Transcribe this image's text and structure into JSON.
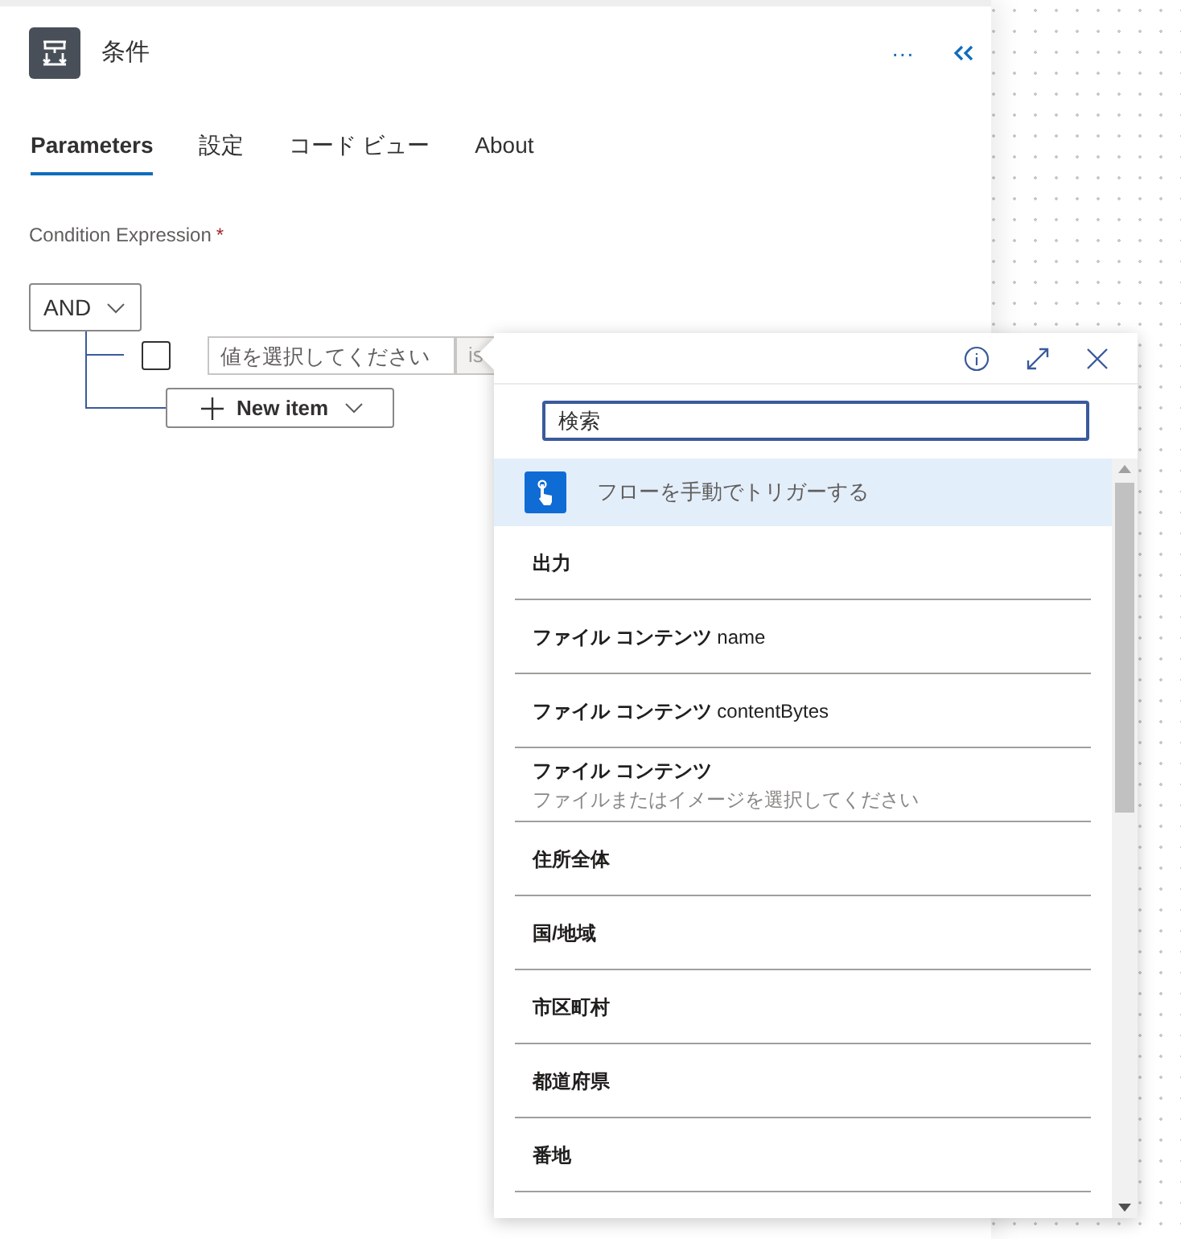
{
  "header": {
    "title": "条件",
    "more": "···"
  },
  "tabs": [
    {
      "label": "Parameters",
      "selected": true
    },
    {
      "label": "設定",
      "selected": false
    },
    {
      "label": "コード ビュー",
      "selected": false
    },
    {
      "label": "About",
      "selected": false
    }
  ],
  "condition": {
    "label": "Condition Expression",
    "required_mark": "*",
    "group": "AND",
    "rows": [
      {
        "checked": false,
        "value_placeholder": "値を選択してください",
        "operator": "is"
      }
    ],
    "new_item": "New item"
  },
  "picker": {
    "search_placeholder": "検索",
    "items": [
      {
        "kind": "trigger",
        "title": "フローを手動でトリガーする",
        "selected": true
      },
      {
        "kind": "field",
        "title": "出力",
        "selected": false
      },
      {
        "kind": "field",
        "title": "**ファイル コンテンツ** name",
        "selected": false
      },
      {
        "kind": "field",
        "title": "**ファイル コンテンツ** contentBytes",
        "selected": false
      },
      {
        "kind": "field",
        "title": "ファイル コンテンツ",
        "subtitle": "ファイルまたはイメージを選択してください",
        "selected": false
      },
      {
        "kind": "field",
        "title": "住所全体",
        "selected": false
      },
      {
        "kind": "field",
        "title": "国/地域",
        "selected": false
      },
      {
        "kind": "field",
        "title": "市区町村",
        "selected": false
      },
      {
        "kind": "field",
        "title": "都道府県",
        "selected": false
      },
      {
        "kind": "field",
        "title": "番地",
        "selected": false
      }
    ]
  }
}
